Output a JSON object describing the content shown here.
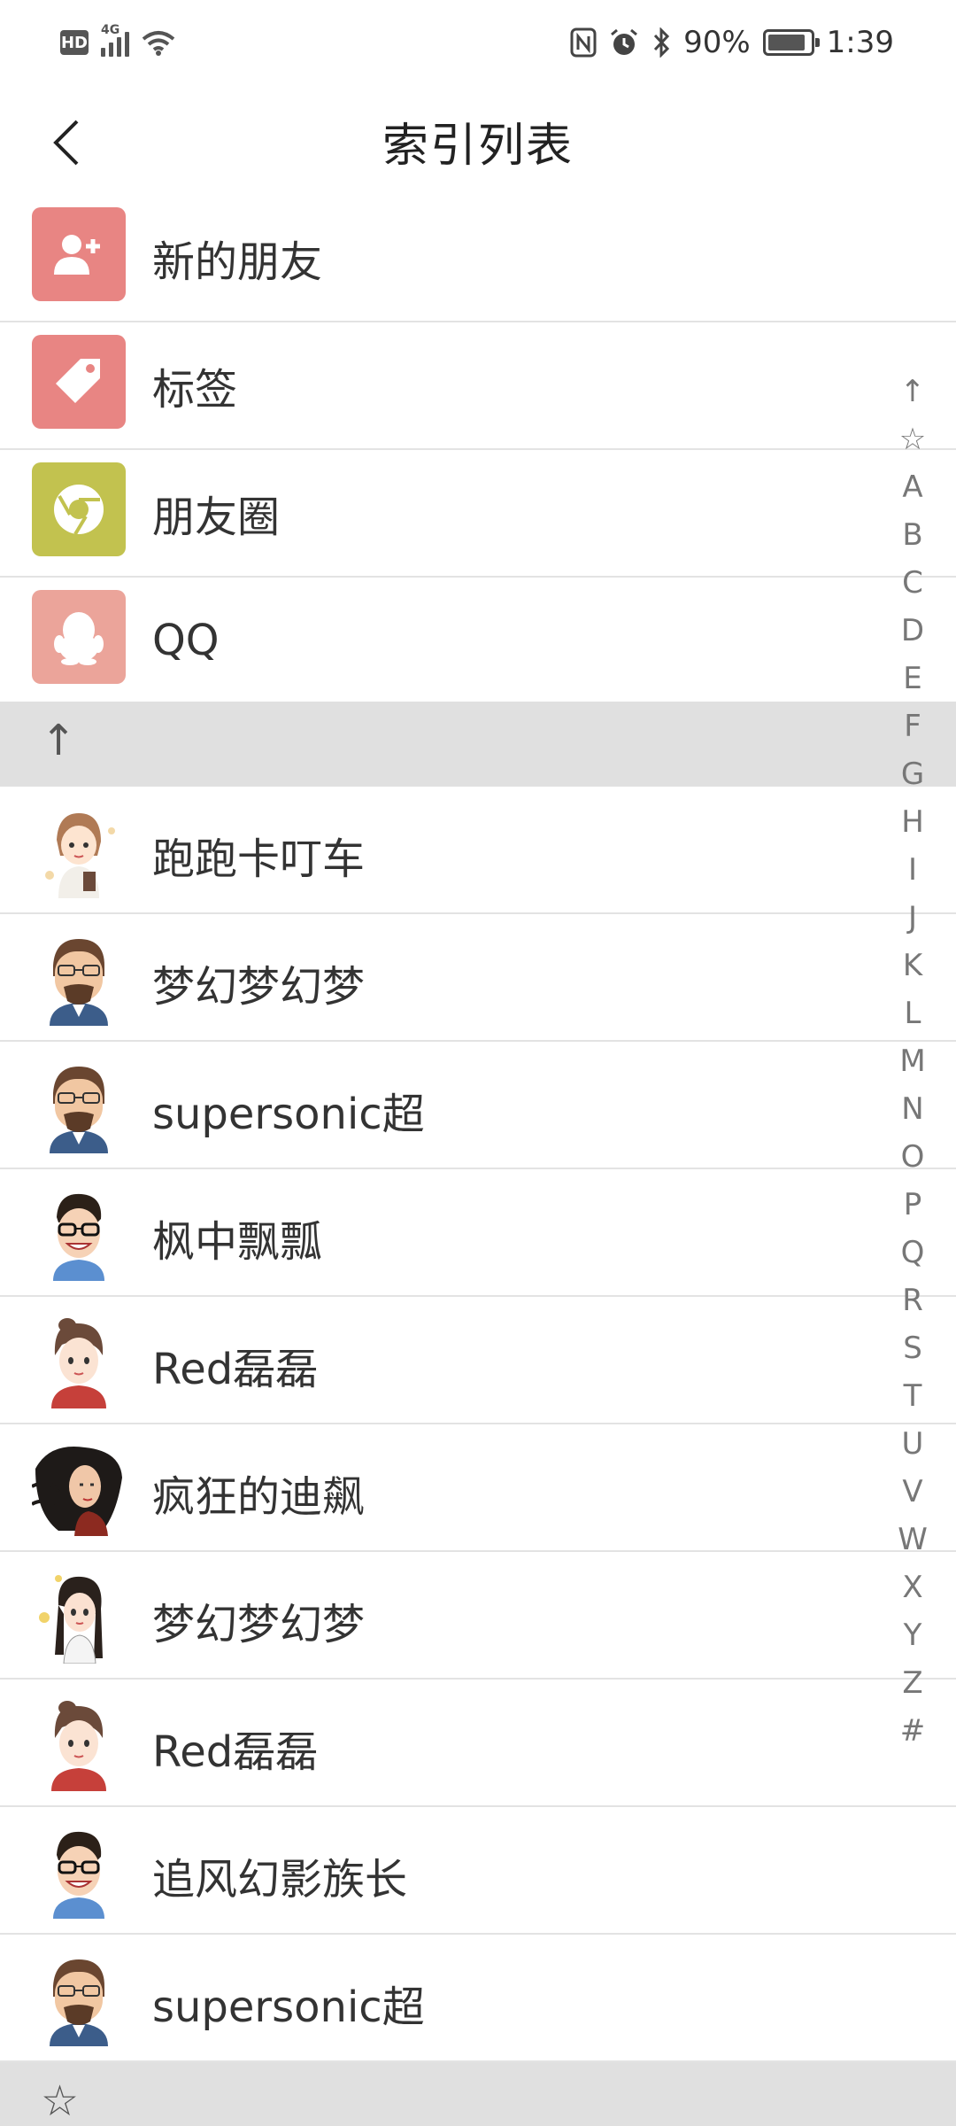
{
  "status_bar": {
    "hd": "HD",
    "network": "4G",
    "battery_text": "90%",
    "battery_level": 0.9,
    "time": "1:39"
  },
  "header": {
    "title": "索引列表"
  },
  "menu": [
    {
      "label": "新的朋友",
      "icon": "add-friend-icon",
      "color": "#e88583"
    },
    {
      "label": "标签",
      "icon": "tag-icon",
      "color": "#e88583"
    },
    {
      "label": "朋友圈",
      "icon": "moments-icon",
      "color": "#c2c24f"
    },
    {
      "label": "QQ",
      "icon": "qq-penguin-icon",
      "color": "#eba49a"
    }
  ],
  "sections": {
    "top_glyph": "↑",
    "star_glyph": "☆"
  },
  "contacts": [
    {
      "name": "跑跑卡叮车",
      "avatar": "girl-brown-hair"
    },
    {
      "name": "梦幻梦幻梦",
      "avatar": "man-glasses-beard"
    },
    {
      "name": "supersonic超",
      "avatar": "man-glasses-beard"
    },
    {
      "name": "枫中飘瓢",
      "avatar": "boy-glasses-blue"
    },
    {
      "name": "Red磊磊",
      "avatar": "girl-red-shirt"
    },
    {
      "name": "疯狂的迪飙",
      "avatar": "girl-long-hair"
    },
    {
      "name": "梦幻梦幻梦",
      "avatar": "girl-cartoon"
    },
    {
      "name": "Red磊磊",
      "avatar": "girl-red-shirt"
    },
    {
      "name": "追风幻影族长",
      "avatar": "boy-glasses-blue"
    },
    {
      "name": "supersonic超",
      "avatar": "man-glasses-beard"
    }
  ],
  "index_letters": [
    "↑",
    "☆",
    "A",
    "B",
    "C",
    "D",
    "E",
    "F",
    "G",
    "H",
    "I",
    "J",
    "K",
    "L",
    "M",
    "N",
    "O",
    "P",
    "Q",
    "R",
    "S",
    "T",
    "U",
    "V",
    "W",
    "X",
    "Y",
    "Z",
    "#"
  ]
}
